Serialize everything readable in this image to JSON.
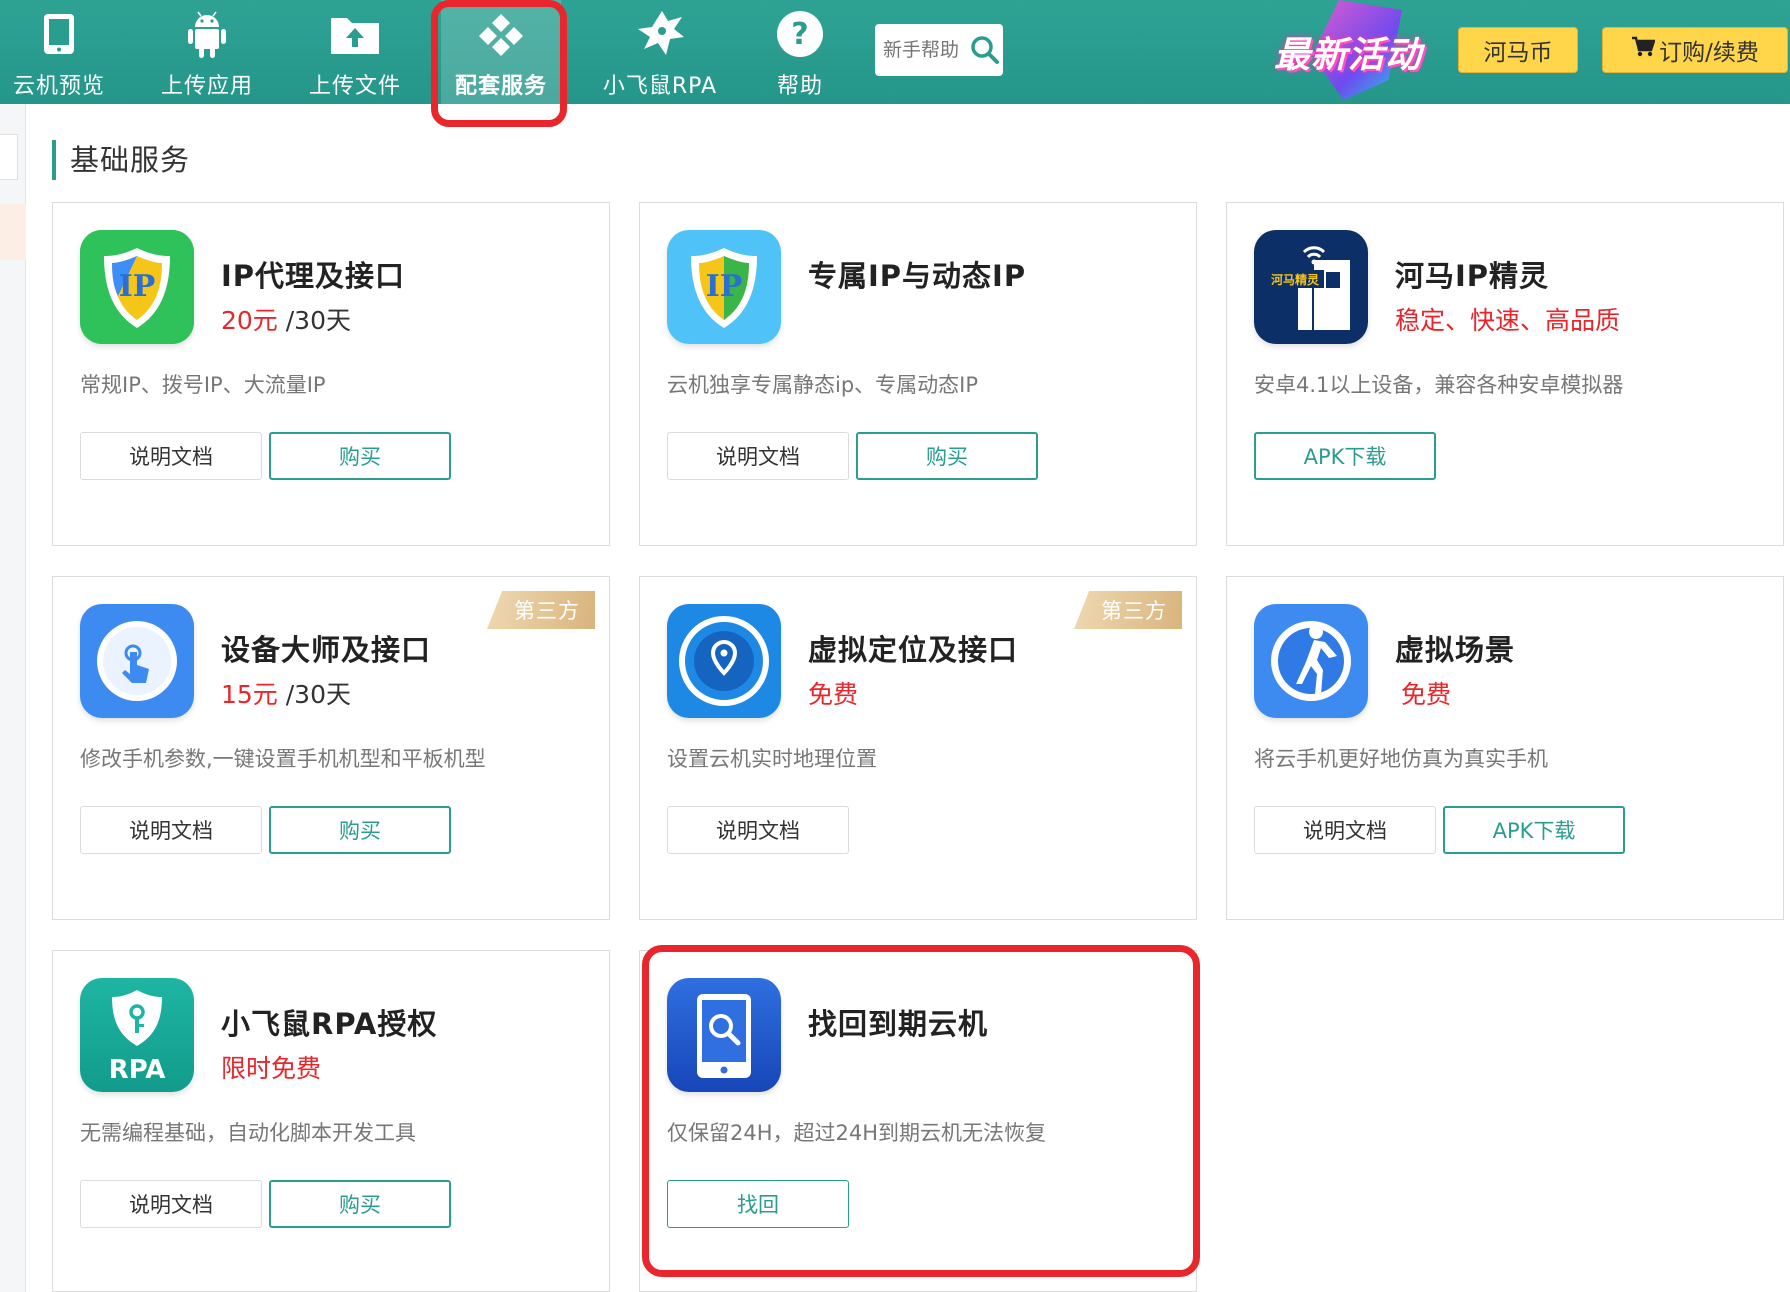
{
  "nav": {
    "items": [
      {
        "label": "云机预览",
        "icon": "phone-icon"
      },
      {
        "label": "上传应用",
        "icon": "android-icon"
      },
      {
        "label": "上传文件",
        "icon": "folder-upload-icon"
      },
      {
        "label": "配套服务",
        "icon": "services-grid-icon",
        "active": true
      },
      {
        "label": "小飞鼠RPA",
        "icon": "flying-squirrel-icon"
      },
      {
        "label": "帮助",
        "icon": "help-icon"
      }
    ],
    "search_placeholder": "新手帮助",
    "promo_label": "最新活动",
    "coin_label": "河马币",
    "order_label": "订购/续费"
  },
  "colors": {
    "brand": "#2a9d8f",
    "price": "#e8262b",
    "highlight": "#e8262b",
    "button_yellow": "#ffd54a"
  },
  "section_title": "基础服务",
  "cards": [
    {
      "title": "IP代理及接口",
      "price_value": "20元",
      "price_period": " /30天",
      "desc": "常规IP、拨号IP、大流量IP",
      "buttons": [
        "说明文档",
        "购买"
      ],
      "icon": "ip-shield-green-icon"
    },
    {
      "title": "专属IP与动态IP",
      "price_value": "",
      "price_period": "",
      "desc": "云机独享专属静态ip、专属动态IP",
      "buttons": [
        "说明文档",
        "购买"
      ],
      "icon": "ip-shield-blue-icon"
    },
    {
      "title": "河马IP精灵",
      "price_value": "稳定、快速、高品质",
      "price_period": "",
      "desc": "安卓4.1以上设备，兼容各种安卓模拟器",
      "buttons": [
        "APK下载"
      ],
      "icon": "hema-ip-icon",
      "icon_text": "河马精灵"
    },
    {
      "title": "设备大师及接口",
      "price_value": "15元",
      "price_period": " /30天",
      "desc": "修改手机参数,一键设置手机机型和平板机型",
      "buttons": [
        "说明文档",
        "购买"
      ],
      "badge": "第三方",
      "icon": "device-master-icon"
    },
    {
      "title": "虚拟定位及接口",
      "price_value": "免费",
      "price_period": "",
      "desc": "设置云机实时地理位置",
      "buttons": [
        "说明文档"
      ],
      "badge": "第三方",
      "icon": "location-pin-icon"
    },
    {
      "title": "虚拟场景",
      "price_value": "免费",
      "price_period": "",
      "desc": "将云手机更好地仿真为真实手机",
      "buttons": [
        "说明文档",
        "APK下载"
      ],
      "icon": "walking-person-icon"
    },
    {
      "title": "小飞鼠RPA授权",
      "price_value": "限时免费",
      "price_period": "",
      "desc": "无需编程基础，自动化脚本开发工具",
      "buttons": [
        "说明文档",
        "购买"
      ],
      "icon": "rpa-shield-icon",
      "icon_text": "RPA"
    },
    {
      "title": "找回到期云机",
      "price_value": "",
      "price_period": "",
      "desc": "仅保留24H，超过24H到期云机无法恢复",
      "buttons": [
        "找回"
      ],
      "icon": "phone-search-icon"
    }
  ]
}
